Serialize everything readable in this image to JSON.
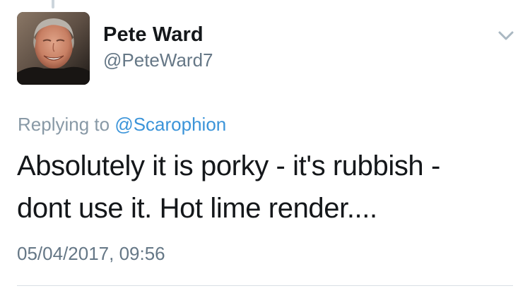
{
  "tweet": {
    "author": {
      "display_name": "Pete Ward",
      "handle": "@PeteWard7",
      "avatar_icon": "profile-photo"
    },
    "menu_icon": "chevron-down-icon",
    "reply_context": {
      "prefix": "Replying to ",
      "mention": "@Scarophion"
    },
    "text_lines": [
      "Absolutely it is porky - it's rubbish -",
      "dont use it.  Hot lime render...."
    ],
    "timestamp": "05/04/2017, 09:56"
  },
  "colors": {
    "name": "#14171a",
    "secondary": "#657786",
    "reply_prefix": "#8899a6",
    "link": "#3b94d9",
    "divider": "#d9dfe4"
  }
}
